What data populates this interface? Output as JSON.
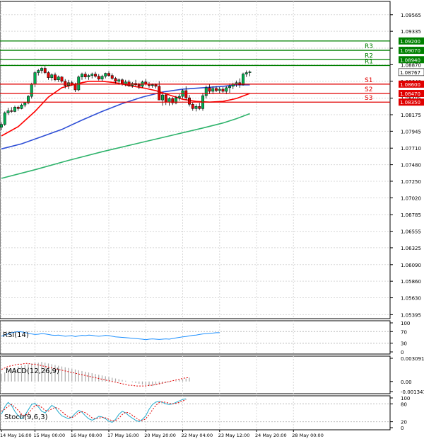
{
  "chart_data": {
    "type": "candlestick",
    "price_axis": {
      "ticks": [
        "1.09565",
        "1.09335",
        "1.09100",
        "1.08870",
        "1.08640",
        "1.08405",
        "1.08175",
        "1.07945",
        "1.07710",
        "1.07480",
        "1.07250",
        "1.07020",
        "1.06785",
        "1.06555",
        "1.06325",
        "1.06090",
        "1.05860",
        "1.05630",
        "1.05395"
      ],
      "range": [
        1.0534,
        1.0975
      ]
    },
    "time_axis": {
      "labels": [
        "14 May 16:00",
        "15 May 00:00",
        "16 May 08:00",
        "17 May 16:00",
        "20 May 20:00",
        "22 May 04:00",
        "23 May 12:00",
        "24 May 20:00",
        "28 May 00:00"
      ],
      "label_bars": [
        0,
        10,
        21,
        32,
        43,
        54,
        65,
        76,
        87
      ]
    },
    "levels": [
      {
        "name": "R3",
        "price": 1.0907,
        "tag": "1.09070",
        "color": "#008000"
      },
      {
        "name": "R2",
        "price": 1.0894,
        "tag": "1.08940",
        "color": "#008000"
      },
      {
        "name": "R1",
        "price": 1.0886,
        "tag": "",
        "color": "#008000"
      },
      {
        "name": "S1",
        "price": 1.086,
        "tag": "1.08600",
        "color": "#e00000"
      },
      {
        "name": "S2",
        "price": 1.0847,
        "tag": "1.08470",
        "color": "#e00000"
      },
      {
        "name": "S3",
        "price": 1.0835,
        "tag": "1.08350",
        "color": "#e00000"
      }
    ],
    "extra_lines": [
      {
        "price": 1.092,
        "tag": "1.09200",
        "color": "#008000"
      }
    ],
    "current_price": {
      "price": 1.08767,
      "tag": "1.08767"
    },
    "candles": [
      [
        1.08,
        1.0807,
        1.0796,
        1.0804
      ],
      [
        1.0804,
        1.0822,
        1.0802,
        1.082
      ],
      [
        1.082,
        1.0827,
        1.0817,
        1.0823
      ],
      [
        1.0823,
        1.0828,
        1.082,
        1.0822
      ],
      [
        1.0822,
        1.083,
        1.0821,
        1.0828
      ],
      [
        1.0828,
        1.083,
        1.0823,
        1.0826
      ],
      [
        1.0826,
        1.0833,
        1.0825,
        1.0831
      ],
      [
        1.0831,
        1.0835,
        1.0828,
        1.0834
      ],
      [
        1.0834,
        1.0845,
        1.0832,
        1.0843
      ],
      [
        1.0843,
        1.0862,
        1.084,
        1.086
      ],
      [
        1.086,
        1.0878,
        1.0856,
        1.0876
      ],
      [
        1.0876,
        1.0881,
        1.0872,
        1.0879
      ],
      [
        1.0879,
        1.0884,
        1.0875,
        1.0882
      ],
      [
        1.0882,
        1.0885,
        1.0874,
        1.0876
      ],
      [
        1.0876,
        1.0878,
        1.0866,
        1.0869
      ],
      [
        1.0869,
        1.0875,
        1.0865,
        1.0873
      ],
      [
        1.0873,
        1.0876,
        1.0864,
        1.0866
      ],
      [
        1.0866,
        1.0872,
        1.0863,
        1.087
      ],
      [
        1.087,
        1.0871,
        1.0862,
        1.0864
      ],
      [
        1.0864,
        1.0867,
        1.0854,
        1.0858
      ],
      [
        1.0858,
        1.0866,
        1.0853,
        1.0862
      ],
      [
        1.0862,
        1.0865,
        1.0858,
        1.086
      ],
      [
        1.086,
        1.0862,
        1.0849,
        1.0852
      ],
      [
        1.0852,
        1.0872,
        1.085,
        1.087
      ],
      [
        1.087,
        1.0876,
        1.0866,
        1.0874
      ],
      [
        1.0874,
        1.0877,
        1.0867,
        1.087
      ],
      [
        1.087,
        1.0874,
        1.0866,
        1.0872
      ],
      [
        1.0872,
        1.0876,
        1.0868,
        1.0874
      ],
      [
        1.0874,
        1.0877,
        1.0869,
        1.0871
      ],
      [
        1.0871,
        1.0874,
        1.0865,
        1.0867
      ],
      [
        1.0867,
        1.0873,
        1.0864,
        1.0871
      ],
      [
        1.0871,
        1.0876,
        1.0868,
        1.0875
      ],
      [
        1.0875,
        1.0878,
        1.087,
        1.0872
      ],
      [
        1.0872,
        1.0875,
        1.0866,
        1.0868
      ],
      [
        1.0868,
        1.087,
        1.0861,
        1.0864
      ],
      [
        1.0864,
        1.0868,
        1.0859,
        1.0866
      ],
      [
        1.0866,
        1.0868,
        1.0858,
        1.086
      ],
      [
        1.086,
        1.0866,
        1.0857,
        1.0863
      ],
      [
        1.0863,
        1.0866,
        1.0856,
        1.0858
      ],
      [
        1.0858,
        1.0863,
        1.0855,
        1.0861
      ],
      [
        1.0861,
        1.0866,
        1.0857,
        1.0859
      ],
      [
        1.0859,
        1.0862,
        1.0853,
        1.0857
      ],
      [
        1.0857,
        1.0865,
        1.0855,
        1.0863
      ],
      [
        1.0863,
        1.0867,
        1.0858,
        1.086
      ],
      [
        1.086,
        1.0863,
        1.0855,
        1.0858
      ],
      [
        1.0858,
        1.0861,
        1.0855,
        1.0859
      ],
      [
        1.0859,
        1.0861,
        1.0854,
        1.0857
      ],
      [
        1.0857,
        1.0864,
        1.0851,
        1.0838
      ],
      [
        1.0838,
        1.0847,
        1.083,
        1.0845
      ],
      [
        1.0845,
        1.0848,
        1.0831,
        1.0835
      ],
      [
        1.0835,
        1.0842,
        1.083,
        1.084
      ],
      [
        1.084,
        1.0842,
        1.0831,
        1.0834
      ],
      [
        1.0834,
        1.0844,
        1.0832,
        1.0841
      ],
      [
        1.0841,
        1.0846,
        1.0837,
        1.0843
      ],
      [
        1.0843,
        1.0853,
        1.084,
        1.0851
      ],
      [
        1.0851,
        1.0857,
        1.0838,
        1.0841
      ],
      [
        1.0841,
        1.0845,
        1.0829,
        1.0832
      ],
      [
        1.0832,
        1.0835,
        1.0823,
        1.0826
      ],
      [
        1.0826,
        1.0832,
        1.0822,
        1.0829
      ],
      [
        1.0829,
        1.0834,
        1.0824,
        1.0826
      ],
      [
        1.0826,
        1.0848,
        1.0823,
        1.0844
      ],
      [
        1.0844,
        1.0858,
        1.084,
        1.0855
      ],
      [
        1.0855,
        1.086,
        1.0846,
        1.085
      ],
      [
        1.085,
        1.0857,
        1.0846,
        1.0854
      ],
      [
        1.0854,
        1.0857,
        1.0849,
        1.0851
      ],
      [
        1.0851,
        1.0856,
        1.0847,
        1.0853
      ],
      [
        1.0853,
        1.0856,
        1.0848,
        1.085
      ],
      [
        1.085,
        1.0857,
        1.0846,
        1.0855
      ],
      [
        1.0855,
        1.0861,
        1.0848,
        1.0857
      ],
      [
        1.0857,
        1.0862,
        1.0853,
        1.086
      ],
      [
        1.086,
        1.0865,
        1.0856,
        1.0862
      ],
      [
        1.0862,
        1.0868,
        1.0855,
        1.0859
      ],
      [
        1.0859,
        1.0876,
        1.0858,
        1.0874
      ],
      [
        1.0874,
        1.0879,
        1.087,
        1.0876
      ],
      [
        1.0876,
        1.0879,
        1.0871,
        1.0877
      ]
    ],
    "ma_fast": [
      [
        0,
        1.0788
      ],
      [
        5,
        1.0801
      ],
      [
        10,
        1.0822
      ],
      [
        14,
        1.0842
      ],
      [
        18,
        1.0855
      ],
      [
        22,
        1.086
      ],
      [
        26,
        1.0864
      ],
      [
        30,
        1.0864
      ],
      [
        34,
        1.0862
      ],
      [
        38,
        1.0858
      ],
      [
        42,
        1.0855
      ],
      [
        46,
        1.0851
      ],
      [
        50,
        1.0845
      ],
      [
        54,
        1.0839
      ],
      [
        58,
        1.0836
      ],
      [
        62,
        1.0835
      ],
      [
        66,
        1.0836
      ],
      [
        70,
        1.084
      ],
      [
        74,
        1.0847
      ]
    ],
    "ma_mid": [
      [
        0,
        1.077
      ],
      [
        6,
        1.0777
      ],
      [
        12,
        1.0787
      ],
      [
        18,
        1.0797
      ],
      [
        24,
        1.081
      ],
      [
        30,
        1.0822
      ],
      [
        36,
        1.0833
      ],
      [
        42,
        1.0842
      ],
      [
        48,
        1.0849
      ],
      [
        54,
        1.0853
      ],
      [
        60,
        1.0855
      ],
      [
        66,
        1.0857
      ],
      [
        70,
        1.0859
      ],
      [
        74,
        1.0859
      ]
    ],
    "ma_slow": [
      [
        0,
        1.0729
      ],
      [
        10,
        1.0741
      ],
      [
        20,
        1.0754
      ],
      [
        30,
        1.0766
      ],
      [
        40,
        1.0777
      ],
      [
        50,
        1.0788
      ],
      [
        60,
        1.0799
      ],
      [
        66,
        1.0806
      ],
      [
        70,
        1.0812
      ],
      [
        74,
        1.0819
      ]
    ],
    "indicators": {
      "rsi": {
        "label": "RSI(14)",
        "ticks": [
          "100",
          "70",
          "30",
          "0"
        ],
        "range": [
          0,
          100
        ],
        "values": [
          54,
          58,
          62,
          66,
          68,
          70,
          69,
          67,
          64,
          62,
          60,
          61,
          63,
          62,
          60,
          58,
          57,
          58,
          56,
          54,
          55,
          56,
          53,
          55,
          57,
          56,
          58,
          57,
          55,
          54,
          55,
          57,
          56,
          54,
          52,
          51,
          50,
          49,
          48,
          47,
          46,
          45,
          44,
          42,
          44,
          45,
          44,
          43,
          44,
          45,
          44,
          46,
          48,
          50,
          52,
          53,
          55,
          57,
          58,
          60,
          62,
          63,
          64,
          65,
          66,
          66
        ]
      },
      "macd": {
        "label": "MACD(12,26,9)",
        "ticks": [
          "0.003091",
          "0.00",
          "-0.001341"
        ],
        "range": [
          -0.001341,
          0.003091
        ],
        "histogram": [
          0.001,
          0.0012,
          0.0014,
          0.0016,
          0.0018,
          0.002,
          0.0021,
          0.0022,
          0.0023,
          0.0024,
          0.0025,
          0.0025,
          0.0026,
          0.0025,
          0.0024,
          0.0023,
          0.0022,
          0.0021,
          0.002,
          0.0019,
          0.0018,
          0.0017,
          0.0016,
          0.0015,
          0.0014,
          0.0013,
          0.0012,
          0.0011,
          0.001,
          0.0009,
          0.0008,
          0.0007,
          0.0006,
          0.0005,
          0.0004,
          0.0003,
          0.0002,
          0.0001,
          0.0,
          -0.0001,
          -0.0002,
          -0.0003,
          -0.0004,
          -0.0005,
          -0.0006,
          -0.0006,
          -0.0005,
          -0.0004,
          -0.0003,
          -0.0002,
          -0.0001,
          0.0,
          0.0001,
          0.0002,
          0.0003,
          0.0004,
          0.0005
        ],
        "signal": [
          0.0016,
          0.0018,
          0.002,
          0.0021,
          0.0022,
          0.0023,
          0.0023,
          0.0024,
          0.0024,
          0.0023,
          0.0023,
          0.0022,
          0.0021,
          0.002,
          0.0019,
          0.0018,
          0.0017,
          0.0016,
          0.0015,
          0.0014,
          0.0013,
          0.0012,
          0.0011,
          0.001,
          0.0009,
          0.0008,
          0.0007,
          0.0006,
          0.0005,
          0.0004,
          0.0003,
          0.0002,
          0.0001,
          0.0,
          -0.0001,
          -0.0002,
          -0.0003,
          -0.0004,
          -0.0005,
          -0.0005,
          -0.0006,
          -0.0006,
          -0.0006,
          -0.0006,
          -0.0005,
          -0.0005,
          -0.0004,
          -0.0003,
          -0.0002,
          -0.0001,
          0.0,
          0.0001,
          0.0002,
          0.0003,
          0.0004,
          0.0005,
          0.0005
        ]
      },
      "stoch": {
        "label": "Stoch(9,6,3)",
        "ticks": [
          "100",
          "80",
          "20",
          "0"
        ],
        "range": [
          0,
          100
        ],
        "main": [
          45,
          70,
          85,
          75,
          55,
          40,
          30,
          42,
          60,
          78,
          82,
          70,
          55,
          50,
          62,
          75,
          68,
          52,
          40,
          35,
          30,
          36,
          48,
          58,
          52,
          40,
          30,
          25,
          30,
          38,
          36,
          30,
          22,
          18,
          28,
          45,
          55,
          50,
          40,
          32,
          25,
          20,
          28,
          40,
          62,
          78,
          86,
          88,
          85,
          80,
          78,
          80,
          85,
          90,
          95,
          97
        ],
        "signal": [
          55,
          62,
          72,
          78,
          70,
          58,
          45,
          40,
          48,
          62,
          74,
          76,
          68,
          58,
          56,
          63,
          68,
          64,
          54,
          44,
          36,
          34,
          40,
          50,
          54,
          50,
          42,
          33,
          30,
          32,
          35,
          33,
          28,
          23,
          24,
          32,
          44,
          52,
          50,
          42,
          34,
          26,
          24,
          30,
          44,
          60,
          75,
          85,
          87,
          85,
          82,
          80,
          82,
          85,
          90,
          94
        ]
      }
    },
    "colors": {
      "bull": "#00b050",
      "bear": "#e00000",
      "ma_fast": "#ff0000",
      "ma_mid": "#2f4fd6",
      "ma_slow": "#2eb36b",
      "rsi": "#1e90ff",
      "macd_hist": "#aaaaaa",
      "macd_signal": "#e00000",
      "stoch_main": "#22aacc",
      "stoch_signal": "#e00000",
      "grid": "#d8d8d8"
    }
  }
}
